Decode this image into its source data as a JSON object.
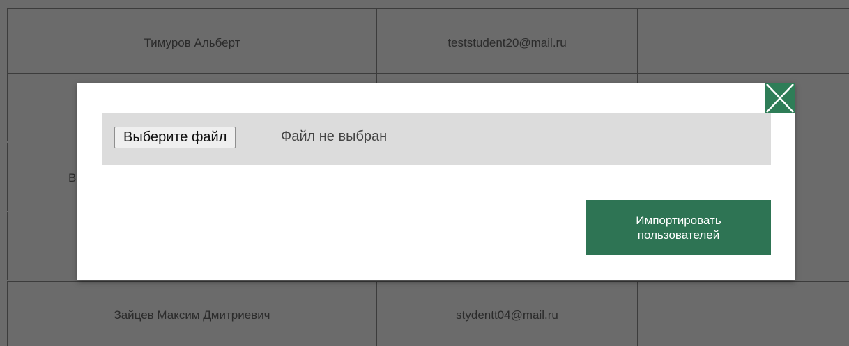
{
  "table": {
    "rows": [
      {
        "name": "Тимуров Альберт",
        "email": "teststudent20@mail.ru",
        "extra": ""
      },
      {
        "name": "",
        "email": "",
        "extra": ""
      },
      {
        "name": "",
        "email": "",
        "extra": ""
      },
      {
        "name": "",
        "email": "",
        "extra": ""
      },
      {
        "name": "Зайцев Максим Дмитриевич",
        "email": "stydentt04@mail.ru",
        "extra": ""
      }
    ],
    "partial_char": "В"
  },
  "modal": {
    "file_input": {
      "button_label": "Выберите файл",
      "status_text": "Файл не выбран"
    },
    "import_button_label": "Импортировать пользователей",
    "close_icon": "close-icon"
  },
  "colors": {
    "overlay": "#6b6b6b",
    "accent": "#2e7454",
    "file_row_bg": "#dcdcdc"
  }
}
